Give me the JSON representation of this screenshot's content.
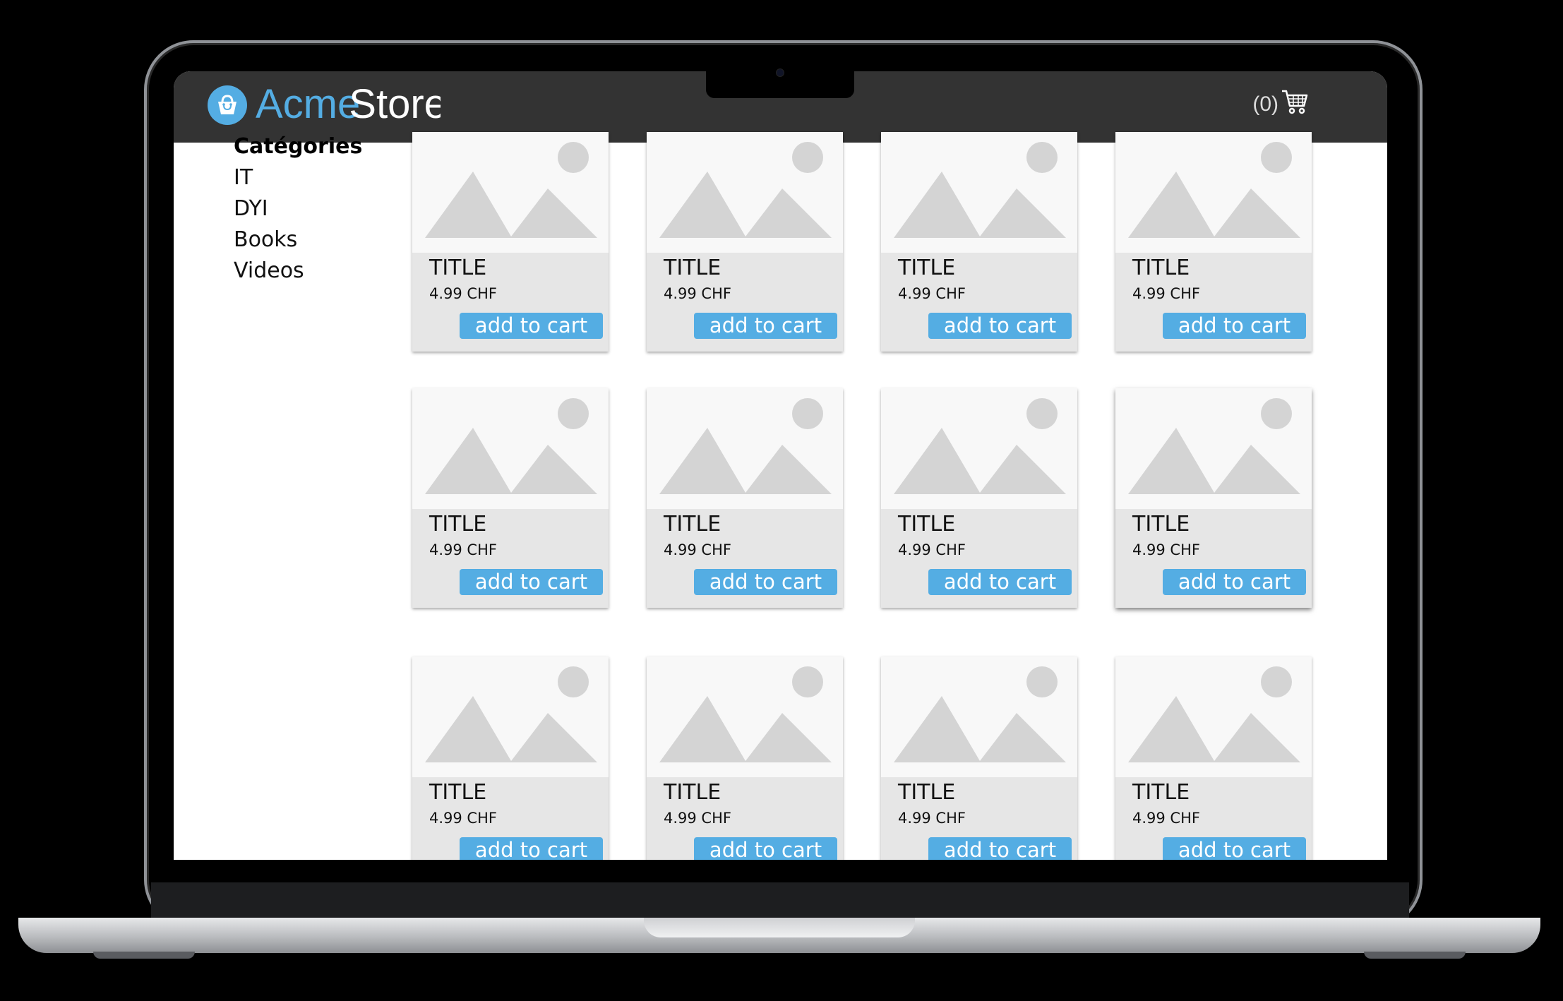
{
  "brand": {
    "name_part1": "Acme",
    "name_part2": "Store"
  },
  "cart": {
    "count_label": "(0)",
    "icon": "cart-icon"
  },
  "sidebar": {
    "heading": "Catégories",
    "items": [
      {
        "label": "IT"
      },
      {
        "label": "DYI"
      },
      {
        "label": "Books"
      },
      {
        "label": "Videos"
      }
    ]
  },
  "products": [
    {
      "title": "TITLE",
      "price": "4.99 CHF",
      "button": "add to cart"
    },
    {
      "title": "TITLE",
      "price": "4.99 CHF",
      "button": "add to cart"
    },
    {
      "title": "TITLE",
      "price": "4.99 CHF",
      "button": "add to cart"
    },
    {
      "title": "TITLE",
      "price": "4.99 CHF",
      "button": "add to cart"
    },
    {
      "title": "TITLE",
      "price": "4.99 CHF",
      "button": "add to cart"
    },
    {
      "title": "TITLE",
      "price": "4.99 CHF",
      "button": "add to cart"
    },
    {
      "title": "TITLE",
      "price": "4.99 CHF",
      "button": "add to cart"
    },
    {
      "title": "TITLE",
      "price": "4.99 CHF",
      "button": "add to cart"
    },
    {
      "title": "TITLE",
      "price": "4.99 CHF",
      "button": "add to cart"
    },
    {
      "title": "TITLE",
      "price": "4.99 CHF",
      "button": "add to cart"
    },
    {
      "title": "TITLE",
      "price": "4.99 CHF",
      "button": "add to cart"
    },
    {
      "title": "TITLE",
      "price": "4.99 CHF",
      "button": "add to cart"
    }
  ],
  "colors": {
    "accent": "#54ade3",
    "navbar": "#333333",
    "card": "#e6e6e6",
    "placeholder_shape": "#d4d4d4"
  }
}
